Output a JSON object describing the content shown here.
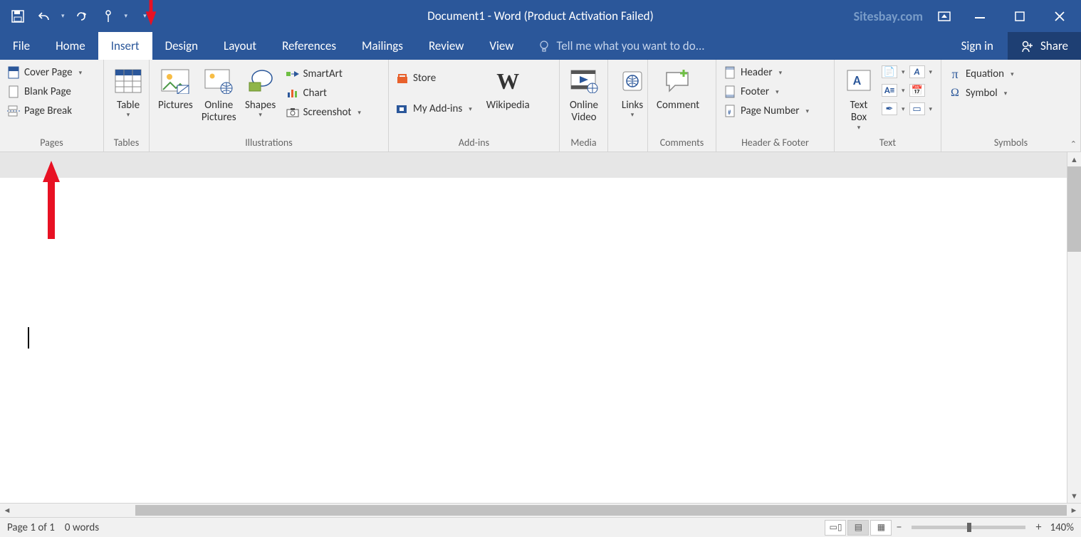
{
  "title": "Document1 - Word (Product Activation Failed)",
  "watermark": "Sitesbay.com",
  "qat": {
    "save": "save",
    "undo": "undo",
    "redo": "redo",
    "touch": "touch"
  },
  "tabs": [
    "File",
    "Home",
    "Insert",
    "Design",
    "Layout",
    "References",
    "Mailings",
    "Review",
    "View"
  ],
  "active_tab": "Insert",
  "tellme_placeholder": "Tell me what you want to do...",
  "signin": "Sign in",
  "share": "Share",
  "groups": {
    "pages": {
      "label": "Pages",
      "cover": "Cover Page",
      "blank": "Blank Page",
      "break": "Page Break"
    },
    "tables": {
      "label": "Tables",
      "table": "Table"
    },
    "illustrations": {
      "label": "Illustrations",
      "pictures": "Pictures",
      "online_pictures": "Online\nPictures",
      "shapes": "Shapes",
      "smartart": "SmartArt",
      "chart": "Chart",
      "screenshot": "Screenshot"
    },
    "addins": {
      "label": "Add-ins",
      "store": "Store",
      "myaddins": "My Add-ins",
      "wikipedia": "Wikipedia"
    },
    "media": {
      "label": "Media",
      "video": "Online\nVideo"
    },
    "links": {
      "label": "",
      "links": "Links"
    },
    "comments": {
      "label": "Comments",
      "comment": "Comment"
    },
    "headerfooter": {
      "label": "Header & Footer",
      "header": "Header",
      "footer": "Footer",
      "pagenum": "Page Number"
    },
    "text": {
      "label": "Text",
      "textbox": "Text\nBox"
    },
    "symbols": {
      "label": "Symbols",
      "equation": "Equation",
      "symbol": "Symbol"
    }
  },
  "status": {
    "page": "Page 1 of 1",
    "words": "0 words",
    "zoom": "140%"
  }
}
